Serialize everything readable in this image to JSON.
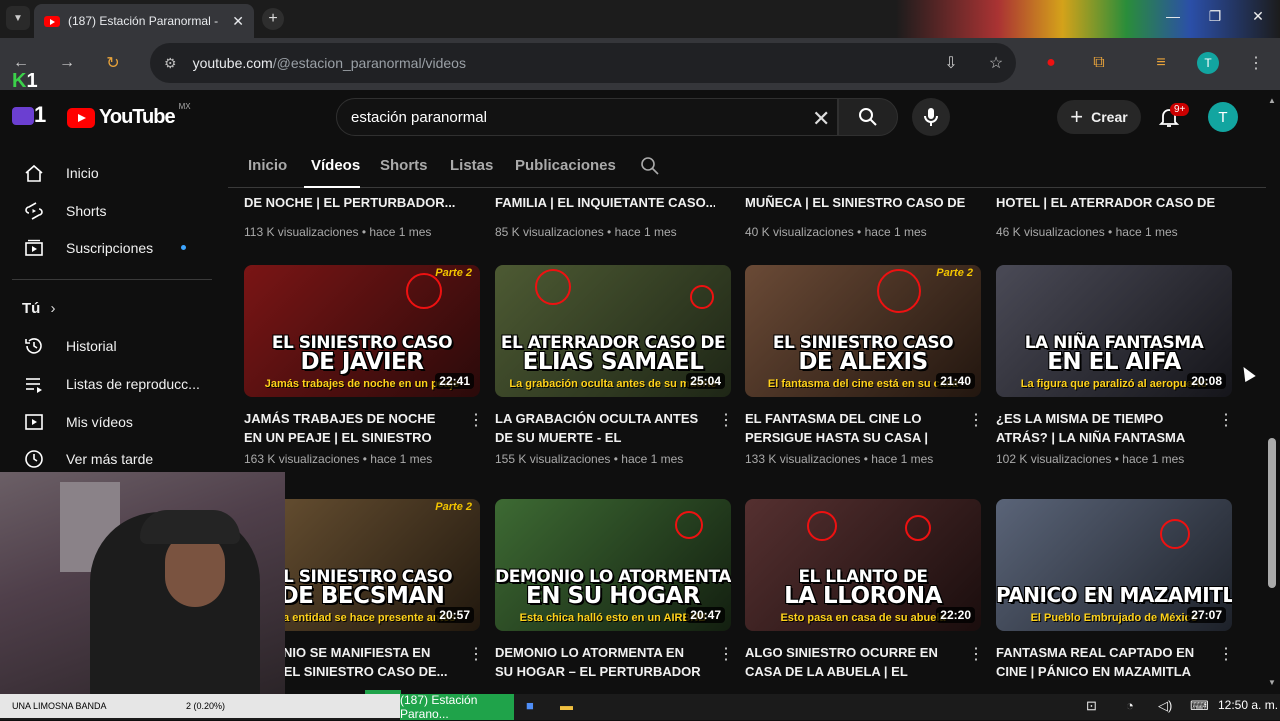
{
  "browser": {
    "tab_title": "(187) Estación Paranormal -",
    "tab_close": "✕",
    "new_tab": "+",
    "url_host": "youtube.com",
    "url_path": "/@estacion_paranormal/videos",
    "profile_initial": "T",
    "window_controls": {
      "minimize": "—",
      "restore": "❐",
      "close": "✕"
    }
  },
  "overlay": {
    "k1_k": "K",
    "k1_num": "1",
    "stream_num": "1"
  },
  "youtube": {
    "logo_text": "YouTube",
    "country_code": "MX",
    "search_value": "estación paranormal",
    "create_label": "Crear",
    "notif_count": "9+",
    "avatar_initial": "T"
  },
  "sidebar": {
    "items": [
      {
        "label": "Inicio",
        "icon": "home-icon"
      },
      {
        "label": "Shorts",
        "icon": "shorts-icon"
      },
      {
        "label": "Suscripciones",
        "icon": "subscriptions-icon"
      }
    ],
    "you_label": "Tú",
    "you_items": [
      {
        "label": "Historial",
        "icon": "history-icon"
      },
      {
        "label": "Listas de reproducc...",
        "icon": "playlists-icon"
      },
      {
        "label": "Mis vídeos",
        "icon": "your-videos-icon"
      },
      {
        "label": "Ver más tarde",
        "icon": "watch-later-icon"
      }
    ]
  },
  "channel_tabs": [
    "Inicio",
    "Vídeos",
    "Shorts",
    "Listas",
    "Publicaciones"
  ],
  "top_row": [
    {
      "title_line2": "DE NOCHE | EL PERTURBADOR...",
      "meta": "113 K visualizaciones • hace 1 mes"
    },
    {
      "title_line2": "FAMILIA | EL INQUIETANTE CASO...",
      "meta": "85 K visualizaciones • hace 1 mes"
    },
    {
      "title_line2": "MUÑECA | EL SINIESTRO CASO DE...",
      "meta": "40 K visualizaciones • hace 1 mes"
    },
    {
      "title_line2": "HOTEL | EL ATERRADOR CASO DE...",
      "meta": "46 K visualizaciones • hace 1 mes"
    }
  ],
  "row2": [
    {
      "l1": "EL SINIESTRO CASO",
      "l2": "DE JAVIER",
      "tag": "Jamás trabajes de noche en un peaje",
      "parte": "Parte 2",
      "duration": "22:41",
      "title": "JAMÁS TRABAJES DE NOCHE EN UN PEAJE | EL SINIESTRO CASO D...",
      "meta": "163 K visualizaciones • hace 1 mes",
      "bg": "#5a1010"
    },
    {
      "l1": "EL ATERRADOR CASO DE",
      "l2": "ELIAS SAMAEL",
      "tag": "La grabación oculta antes de su muerte",
      "parte": "",
      "duration": "25:04",
      "title": "LA GRABACIÓN OCULTA ANTES DE SU MUERTE - EL ATERRADOR CAS...",
      "meta": "155 K visualizaciones • hace 1 mes",
      "bg": "#3d4a2a"
    },
    {
      "l1": "EL SINIESTRO CASO",
      "l2": "DE ALEXIS",
      "tag": "El fantasma del cine está en su casa",
      "parte": "Parte 2",
      "duration": "21:40",
      "title": "EL FANTASMA DEL CINE LO PERSIGUE HASTA SU CASA | EL...",
      "meta": "133 K visualizaciones • hace 1 mes",
      "bg": "#4a3326"
    },
    {
      "l1": "LA NIÑA FANTASMA",
      "l2": "EN EL AIFA",
      "tag": "La figura que paralizó al aeropuerto",
      "parte": "",
      "duration": "20:08",
      "title": "¿ES LA MISMA DE TIEMPO ATRÁS? | LA NIÑA FANTASMA DEL AIFA",
      "meta": "102 K visualizaciones • hace 1 mes",
      "bg": "#2c2c34"
    }
  ],
  "row3": [
    {
      "l1": "EL SINIESTRO CASO",
      "l2": "DE BECSMAN",
      "tag": "Una entidad se hace presente antes",
      "parte": "Parte 2",
      "duration": "20:57",
      "title": "DEMONIO SE MANIFIESTA EN SU... | EL SINIESTRO CASO DE...",
      "meta": "",
      "bg": "#4a3a2a"
    },
    {
      "l1": "DEMONIO LO ATORMENTA",
      "l2": "EN SU HOGAR",
      "tag": "Esta chica halló esto en un AIRBNB",
      "parte": "",
      "duration": "20:47",
      "title": "DEMONIO LO ATORMENTA EN SU HOGAR – EL PERTURBADOR CAS...",
      "meta": "",
      "bg": "#2f4a2a"
    },
    {
      "l1": "EL LLANTO DE",
      "l2": "LA LLORONA",
      "tag": "Esto pasa en casa de su abuela",
      "parte": "",
      "duration": "22:20",
      "title": "ALGO SINIESTRO OCURRE EN CASA DE LA ABUELA | EL LLANTO DE LA...",
      "meta": "",
      "bg": "#3a2a2a"
    },
    {
      "l1": "",
      "l2": "PANICO EN MAZAMITLA",
      "tag": "El Pueblo Embrujado de México",
      "parte": "",
      "duration": "27:07",
      "title": "FANTASMA REAL CAPTADO EN CINE | PÁNICO EN MAZAMITLA (E...",
      "meta": "",
      "bg": "#3a4250"
    }
  ],
  "taskbar": {
    "label_left": "UNA LIMOSNA BANDA",
    "label_pct": "2 (0.20%)",
    "active_app": "(187) Estación Parano...",
    "time": "12:50 a. m."
  }
}
